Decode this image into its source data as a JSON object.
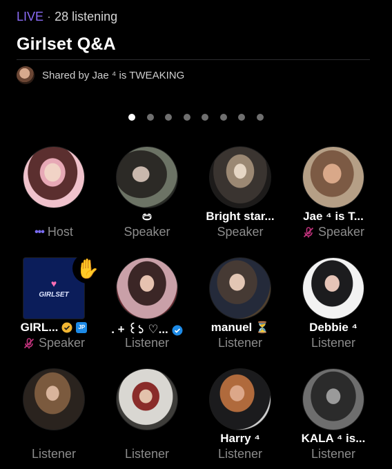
{
  "header": {
    "live_label": "LIVE",
    "separator": "·",
    "listening": "28 listening",
    "title": "Girlset Q&A",
    "shared_by": "Shared by Jae ⁴ is TWEAKING"
  },
  "pager": {
    "count": 8,
    "active_index": 0
  },
  "colors": {
    "accent": "#8b6cf6",
    "muted_text": "#8c8c8c",
    "mic_off": "#c2337d",
    "verified_gold": "#f2b632",
    "verified_blue": "#1d8ae6",
    "background": "#000000"
  },
  "participants": [
    {
      "name": "",
      "role": "Host",
      "role_icon": "host-dots-icon"
    },
    {
      "name": "ඏ",
      "role": "Speaker"
    },
    {
      "name": "Bright star...",
      "role": "Speaker"
    },
    {
      "name": "Jae ⁴ is T...",
      "role": "Speaker",
      "role_icon": "mic-off-icon"
    },
    {
      "name": "GIRL...",
      "role": "Speaker",
      "role_icon": "mic-off-icon",
      "badges": [
        "gold-verified-icon",
        "affiliate-badge-icon"
      ],
      "hand_raised": "✋",
      "avatar_text": "GIRLSET"
    },
    {
      "name": ". + ꒰১ ♡...",
      "role": "Listener",
      "badges": [
        "blue-verified-icon"
      ]
    },
    {
      "name": "manuel",
      "role": "Listener",
      "badges": [
        "hourglass-icon"
      ],
      "badge_text": "⏳"
    },
    {
      "name": "Debbie ⁴",
      "role": "Listener"
    },
    {
      "name": "",
      "role": "Listener"
    },
    {
      "name": "",
      "role": "Listener"
    },
    {
      "name": "Harry ⁴",
      "role": "Listener"
    },
    {
      "name": "KALA ⁴ is...",
      "role": "Listener"
    }
  ]
}
